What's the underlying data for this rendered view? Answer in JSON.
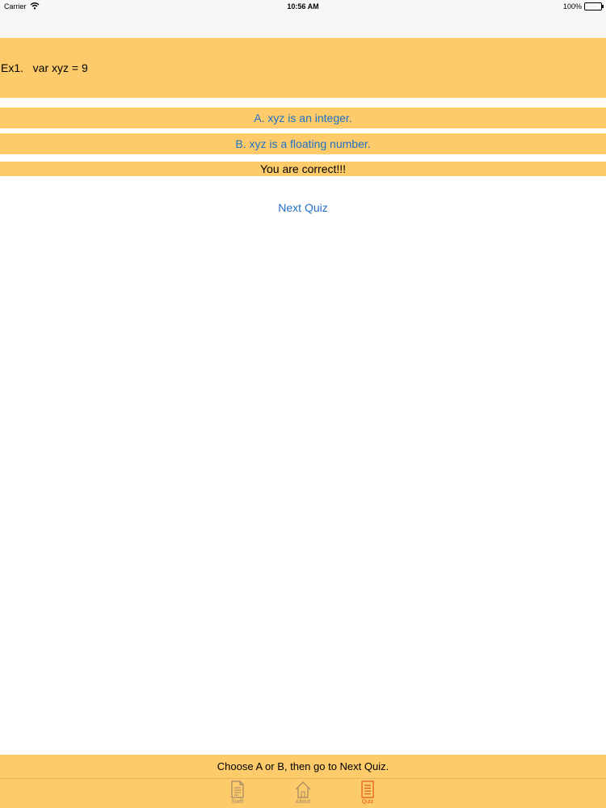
{
  "status_bar": {
    "carrier": "Carrier",
    "time": "10:56 AM",
    "battery": "100%",
    "icons": [
      "wifi-icon",
      "battery-icon"
    ]
  },
  "colors": {
    "panel": "#fecb6b",
    "link": "#1f70c6",
    "tab_active": "#e05a1a",
    "tab_inactive": "#a08866"
  },
  "quiz": {
    "question": "Ex1.   var xyz = 9",
    "answer_a": "A. xyz is an integer.",
    "answer_b": "B. xyz is a floating number.",
    "result": "You are correct!!!",
    "next_label": "Next Quiz",
    "instruction": "Choose A or B, then go to Next Quiz."
  },
  "tabs": [
    {
      "label": "Swift",
      "icon": "document-icon",
      "active": false
    },
    {
      "label": "About",
      "icon": "home-icon",
      "active": false
    },
    {
      "label": "Quiz",
      "icon": "list-icon",
      "active": true
    }
  ]
}
